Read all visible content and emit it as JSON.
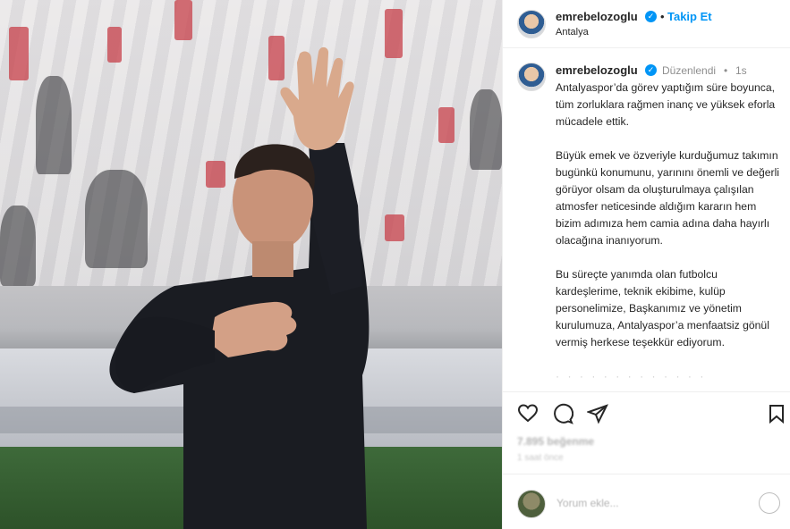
{
  "post": {
    "image_alt": "Man waving in a stadium with hand on chest",
    "header": {
      "username": "emrebelozoglu",
      "separator": "•",
      "follow_label": "Takip Et",
      "location": "Antalya"
    },
    "caption": {
      "username": "emrebelozoglu",
      "edited": "Düzenlendi",
      "separator": "•",
      "time": "1s",
      "paragraphs": [
        "Antalyaspor’da görev yaptığım süre boyunca, tüm zorluklara rağmen inanç ve yüksek eforla mücadele ettik.",
        "Büyük emek ve özveriyle kurduğumuz takımın bugünkü konumunu, yarınını önemli ve değerli görüyor olsam da oluşturulmaya çalışılan atmosfer neticesinde aldığım kararın hem bizim adımıza hem camia adına daha hayırlı olacağına inanıyorum.",
        "Bu süreçte yanımda olan futbolcu kardeşlerime, teknik ekibime, kulüp personelimize, Başkanımız ve yönetim kurulumuza, Antalyaspor’a menfaatsiz gönül vermiş herkese teşekkür ediyorum."
      ],
      "faded_line": "· · · · · · · · · · · · ·"
    },
    "actions": {
      "like_icon": "heart-icon",
      "comment_icon": "comment-icon",
      "share_icon": "send-icon",
      "save_icon": "bookmark-icon"
    },
    "likes_text": "7.895 beğenme",
    "time_ago": "1 saat önce",
    "comment": {
      "placeholder": "Yorum ekle..."
    }
  }
}
